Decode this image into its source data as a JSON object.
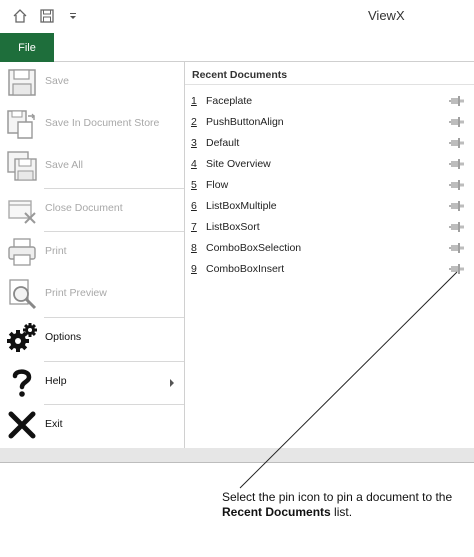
{
  "app": {
    "title": "ViewX"
  },
  "qat": {
    "icons": [
      "home-icon",
      "save-icon",
      "customize-qat-icon"
    ]
  },
  "ribbon": {
    "file_tab_label": "File"
  },
  "file_menu": {
    "items": [
      {
        "label": "Save",
        "icon": "save-icon",
        "enabled": false
      },
      {
        "label": "Save In Document Store",
        "icon": "save-in-document-store-icon",
        "enabled": false
      },
      {
        "label": "Save All",
        "icon": "save-all-icon",
        "enabled": false
      },
      {
        "label": "Close Document",
        "icon": "close-document-icon",
        "enabled": false
      },
      {
        "label": "Print",
        "icon": "print-icon",
        "enabled": false
      },
      {
        "label": "Print Preview",
        "icon": "print-preview-icon",
        "enabled": false
      },
      {
        "label": "Options",
        "icon": "gears-icon",
        "enabled": true
      },
      {
        "label": "Help",
        "icon": "help-icon",
        "enabled": true
      },
      {
        "label": "Exit",
        "icon": "exit-icon",
        "enabled": true
      }
    ]
  },
  "recent": {
    "title": "Recent Documents",
    "documents": [
      {
        "num": "1",
        "name": "Faceplate"
      },
      {
        "num": "2",
        "name": "PushButtonAlign"
      },
      {
        "num": "3",
        "name": "Default"
      },
      {
        "num": "4",
        "name": "Site Overview"
      },
      {
        "num": "5",
        "name": "Flow"
      },
      {
        "num": "6",
        "name": "ListBoxMultiple"
      },
      {
        "num": "7",
        "name": "ListBoxSort"
      },
      {
        "num": "8",
        "name": "ComboBoxSelection"
      },
      {
        "num": "9",
        "name": "ComboBoxInsert"
      }
    ]
  },
  "callout": {
    "prefix": "Select the pin icon to pin a document to the",
    "emphasis": "Recent Documents",
    "suffix": "list."
  },
  "colors": {
    "file_tab": "#1e6e3b",
    "disabled_text": "#a8a8a8"
  }
}
